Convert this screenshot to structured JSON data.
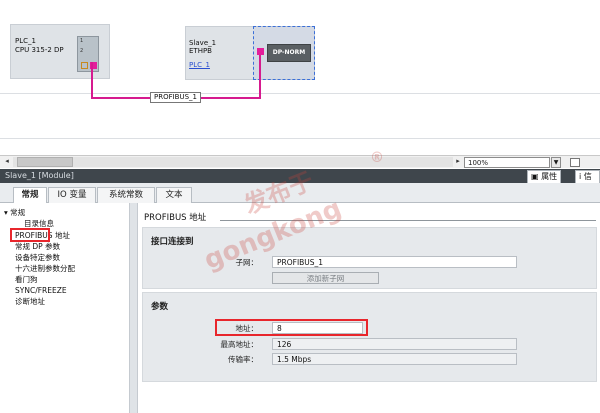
{
  "network": {
    "plc": {
      "name": "PLC_1",
      "type": "CPU 315-2 DP"
    },
    "slave": {
      "name": "Slave_1",
      "type": "ETHPB",
      "link": "PLC_1",
      "module_label": "DP-NORM"
    },
    "bus_label": "PROFIBUS_1",
    "zoom": "100%"
  },
  "inspector": {
    "title": "Slave_1 [Module]",
    "right_tabs": [
      "属性",
      "信"
    ],
    "tabs": [
      "常规",
      "IO 变量",
      "系统常数",
      "文本"
    ],
    "active_tab": 0
  },
  "nav": {
    "root": "常规",
    "items": [
      "目录信息",
      "PROFIBUS 地址",
      "常规 DP 参数",
      "设备特定参数",
      "十六进制参数分配",
      "看门狗",
      "SYNC/FREEZE",
      "诊断地址"
    ]
  },
  "content": {
    "section_title": "PROFIBUS 地址",
    "interface": {
      "title": "接口连接到",
      "subnet_label": "子网：",
      "subnet_value": "PROFIBUS_1",
      "add_subnet_button": "添加新子网"
    },
    "params": {
      "title": "参数",
      "address_label": "地址：",
      "address_value": "8",
      "highest_label": "最高地址：",
      "highest_value": "126",
      "rate_label": "传输率：",
      "rate_value": "1.5 Mbps"
    }
  },
  "watermark": {
    "line1": "发布于",
    "line2": "gongkong",
    "mark": "®"
  },
  "colors": {
    "bus": "#d61a8f",
    "highlight": "#e8262c",
    "header": "#3f464c"
  }
}
